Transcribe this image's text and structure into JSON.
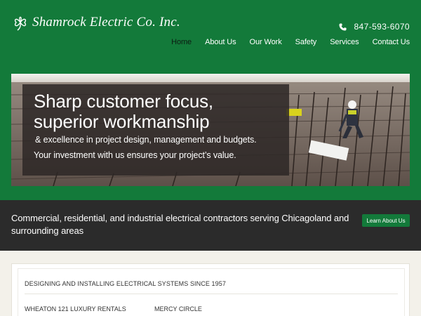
{
  "brand": {
    "name": "Shamrock Electric Co. Inc.",
    "logo_icon": "shamrock-icon"
  },
  "header": {
    "phone": "847-593-6070",
    "phone_icon": "phone-icon",
    "nav": [
      {
        "label": "Home",
        "active": true
      },
      {
        "label": "About Us"
      },
      {
        "label": "Our Work"
      },
      {
        "label": "Safety"
      },
      {
        "label": "Services"
      },
      {
        "label": "Contact Us"
      }
    ]
  },
  "hero": {
    "title_line1": "Sharp customer focus,",
    "title_line2": "superior workmanship",
    "subtitle": "& excellence in project design, management and budgets.",
    "subtitle2": "Your investment with us ensures your project’s value."
  },
  "band": {
    "text": "Commercial, residential, and industrial electrical contractors serving Chicagoland and surrounding areas",
    "button": "Learn About Us"
  },
  "content": {
    "heading": "DESIGNING AND INSTALLING ELECTRICAL SYSTEMS SINCE 1957",
    "projects": [
      "WHEATON 121 LUXURY RENTALS",
      "MERCY CIRCLE"
    ]
  },
  "colors": {
    "brand_green": "#137a3a",
    "band_dark": "#2b2b2b",
    "page_bg": "#f3f1ea"
  }
}
